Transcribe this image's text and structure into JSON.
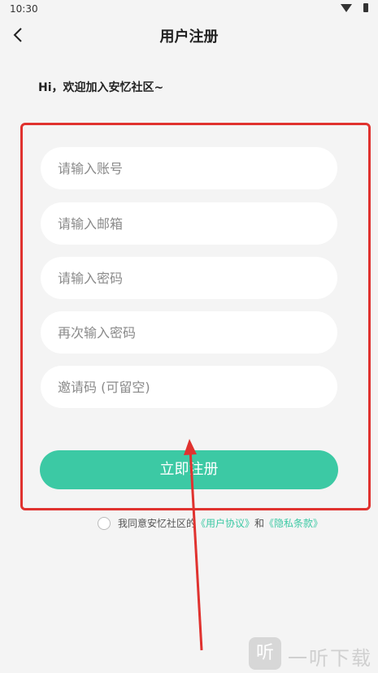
{
  "status_bar": {
    "time": "10:30"
  },
  "header": {
    "title": "用户注册"
  },
  "welcome_text": "Hi，欢迎加入安忆社区~",
  "form": {
    "account_placeholder": "请输入账号",
    "email_placeholder": "请输入邮箱",
    "password_placeholder": "请输入密码",
    "confirm_password_placeholder": "再次输入密码",
    "invite_code_placeholder": "邀请码 (可留空)"
  },
  "register_button": "立即注册",
  "agreement": {
    "prefix": "我同意安忆社区的",
    "user_agreement": "《用户协议》",
    "and": "和",
    "privacy_policy": "《隐私条款》",
    "checked": false
  },
  "watermark": {
    "logo_char": "听",
    "text": "一听下载"
  },
  "colors": {
    "accent": "#3cc9a4",
    "highlight": "#e0322f",
    "background": "#f4f4f4"
  }
}
